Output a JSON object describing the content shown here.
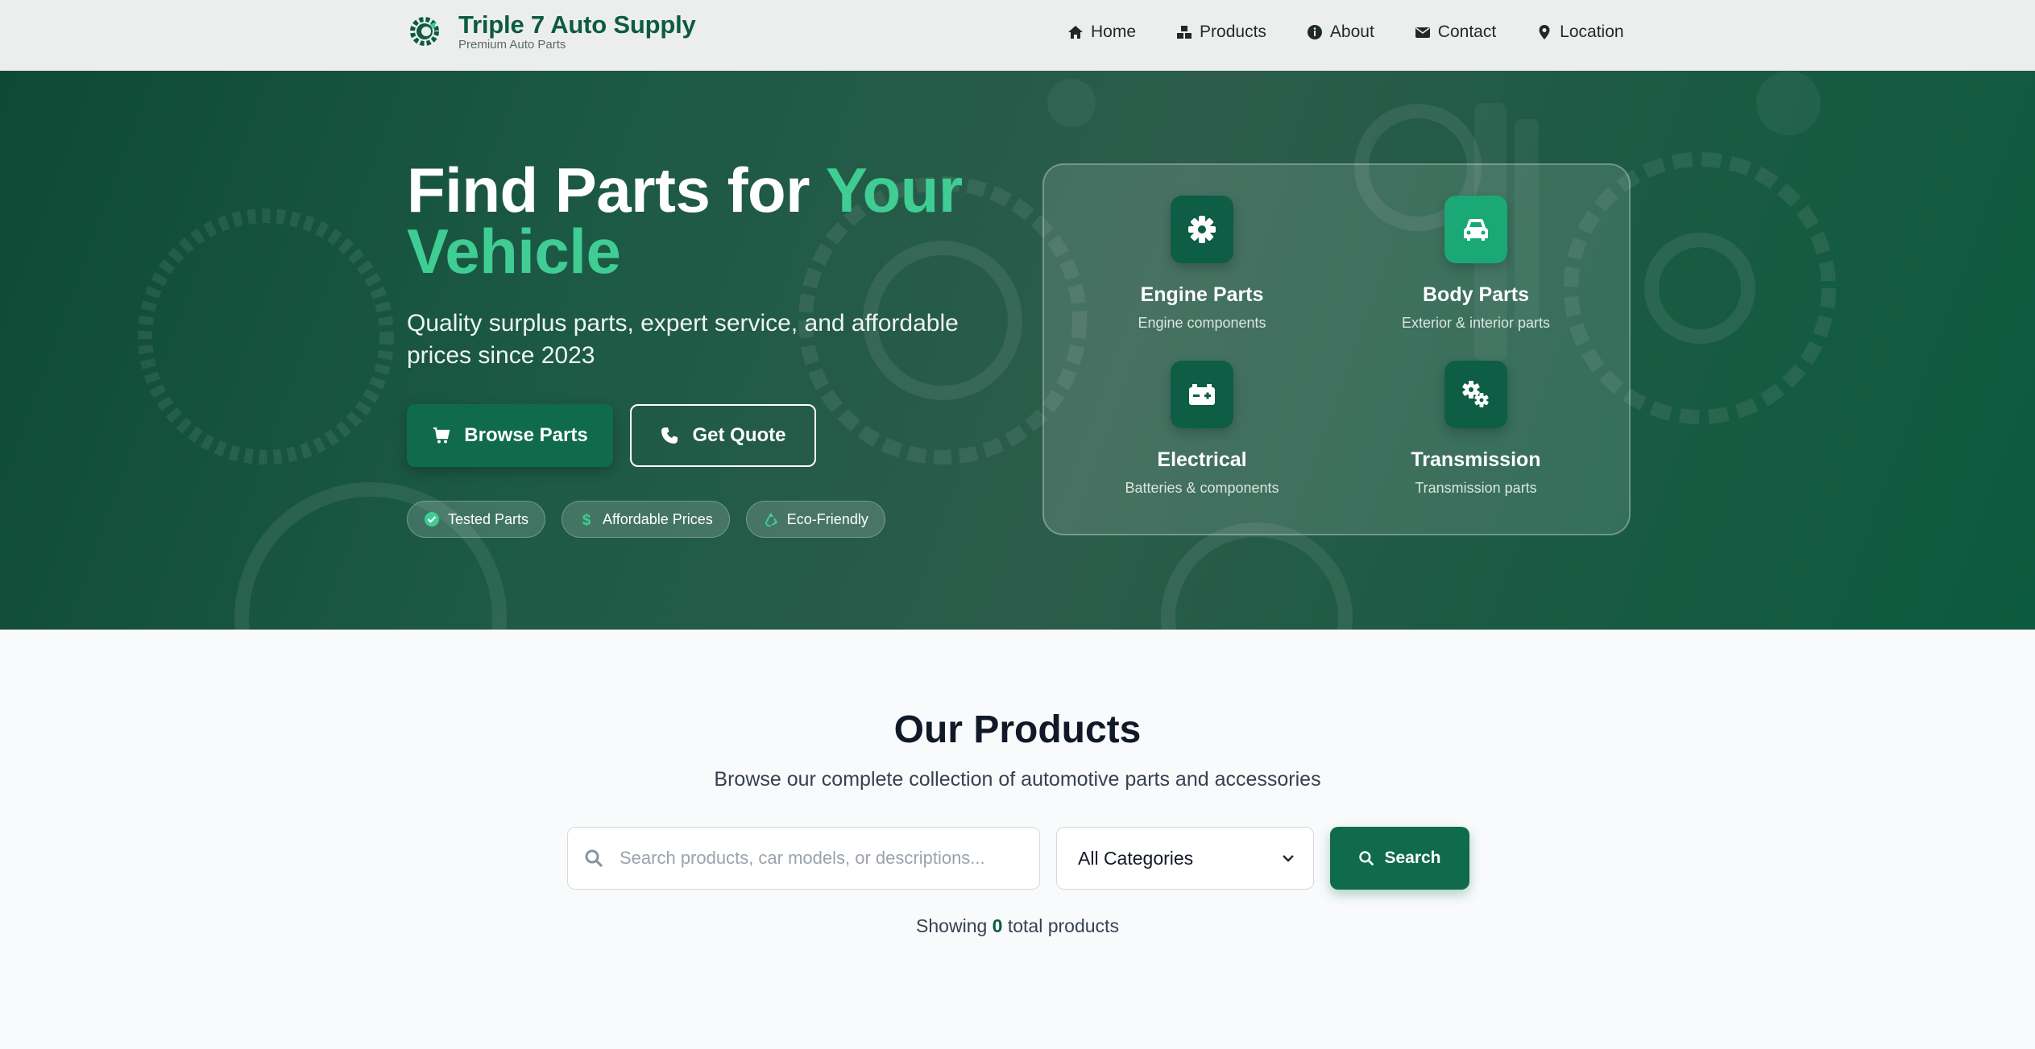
{
  "nav": {
    "brand_title": "Triple 7 Auto Supply",
    "brand_subtitle": "Premium Auto Parts",
    "links": [
      {
        "label": "Home",
        "icon": "home-icon"
      },
      {
        "label": "Products",
        "icon": "boxes-icon"
      },
      {
        "label": "About",
        "icon": "info-icon"
      },
      {
        "label": "Contact",
        "icon": "envelope-icon"
      },
      {
        "label": "Location",
        "icon": "map-pin-icon"
      }
    ]
  },
  "hero": {
    "title_plain": "Find Parts for",
    "title_accent_1": "Your",
    "title_accent_2": "Vehicle",
    "subtitle": "Quality surplus parts, expert service, and affordable prices since 2023",
    "primary_button": "Browse Parts",
    "secondary_button": "Get Quote",
    "pills": [
      {
        "label": "Tested Parts",
        "icon": "check-circle-icon"
      },
      {
        "label": "Affordable Prices",
        "icon": "dollar-icon"
      },
      {
        "label": "Eco-Friendly",
        "icon": "recycle-icon"
      }
    ],
    "categories": [
      {
        "name": "Engine Parts",
        "desc": "Engine components",
        "icon": "cog-icon"
      },
      {
        "name": "Body Parts",
        "desc": "Exterior & interior parts",
        "icon": "car-icon"
      },
      {
        "name": "Electrical",
        "desc": "Batteries & components",
        "icon": "battery-icon"
      },
      {
        "name": "Transmission",
        "desc": "Transmission parts",
        "icon": "cogs-icon"
      }
    ]
  },
  "products": {
    "title": "Our Products",
    "subtitle": "Browse our complete collection of automotive parts and accessories",
    "search_placeholder": "Search products, car models, or descriptions...",
    "search_value": "",
    "category_selected": "All Categories",
    "search_button": "Search",
    "showing_prefix": "Showing",
    "showing_count": "0",
    "showing_suffix": "total products"
  },
  "colors": {
    "brand_green": "#0f6b4c",
    "accent_green": "#3fcd94",
    "nav_bg": "#eceeed"
  }
}
